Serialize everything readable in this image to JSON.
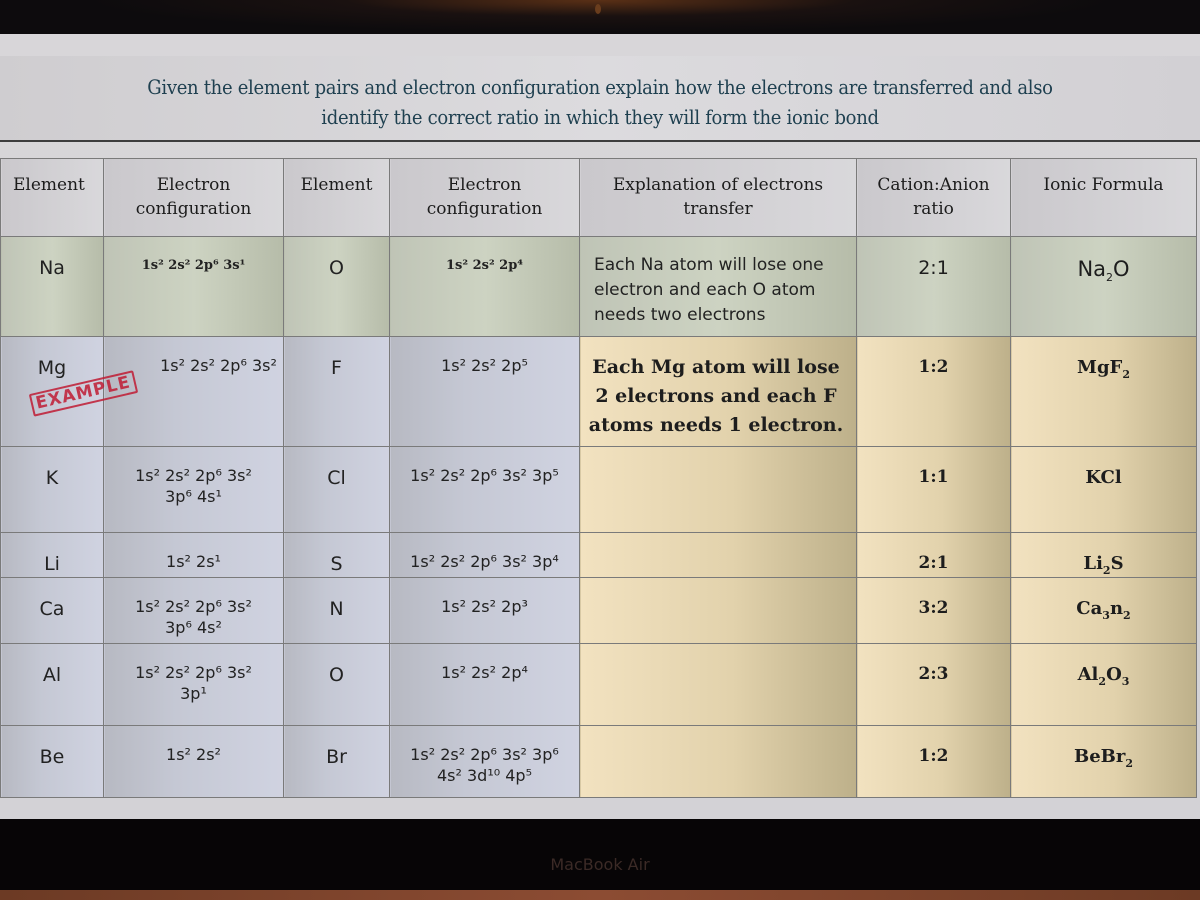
{
  "device": {
    "brand_label": "MacBook Air"
  },
  "worksheet": {
    "title_line1": "Given the element pairs and electron configuration explain how the electrons are transferred and also",
    "title_line2": "identify the correct ratio in which they will form the ionic bond",
    "stamp": "EXAMPLE",
    "headers": {
      "element1": "Element",
      "config1_line1": "Electron",
      "config1_line2": "configuration",
      "element2": "Element",
      "config2_line1": "Electron",
      "config2_line2": "configuration",
      "explanation_line1": "Explanation of electrons",
      "explanation_line2": "transfer",
      "ratio_line1": "Cation:Anion",
      "ratio_line2": "ratio",
      "formula": "Ionic Formula"
    },
    "rows": [
      {
        "element1": "Na",
        "config1": [
          "1s² 2s² 2p⁶ 3s¹"
        ],
        "element2": "O",
        "config2": [
          "1s² 2s² 2p⁴"
        ],
        "explanation": [
          "Each Na atom will lose one",
          "electron and each O atom",
          "needs two electrons"
        ],
        "ratio": "2:1",
        "formula": {
          "parts": [
            [
              "Na",
              "2"
            ],
            [
              "O",
              ""
            ]
          ]
        }
      },
      {
        "element1": "Mg",
        "config1": [
          "1s² 2s² 2p⁶ 3s²"
        ],
        "element2": "F",
        "config2": [
          "1s² 2s² 2p⁵"
        ],
        "explanation": [
          "Each Mg atom will lose",
          "2 electrons and each F",
          "atoms needs 1 electron."
        ],
        "ratio": "1:2",
        "formula": {
          "parts": [
            [
              "MgF",
              "2"
            ]
          ]
        }
      },
      {
        "element1": "K",
        "config1": [
          "1s² 2s² 2p⁶ 3s²",
          "3p⁶ 4s¹"
        ],
        "element2": "Cl",
        "config2": [
          "1s² 2s² 2p⁶ 3s² 3p⁵"
        ],
        "explanation": [],
        "ratio": "1:1",
        "formula": {
          "parts": [
            [
              "KCl",
              ""
            ]
          ]
        }
      },
      {
        "element1": "Li",
        "config1": [
          "1s² 2s¹"
        ],
        "element2": "S",
        "config2": [
          "1s² 2s² 2p⁶ 3s² 3p⁴"
        ],
        "explanation": [],
        "ratio": "2:1",
        "formula": {
          "parts": [
            [
              "Li",
              "2"
            ],
            [
              "S",
              ""
            ]
          ]
        }
      },
      {
        "element1": "Ca",
        "config1": [
          "1s² 2s² 2p⁶ 3s²",
          "3p⁶ 4s²"
        ],
        "element2": "N",
        "config2": [
          "1s² 2s² 2p³"
        ],
        "explanation": [],
        "ratio": "3:2",
        "formula": {
          "parts": [
            [
              "Ca",
              "3"
            ],
            [
              "n",
              "2"
            ]
          ]
        }
      },
      {
        "element1": "Al",
        "config1": [
          "1s² 2s² 2p⁶ 3s²",
          "3p¹"
        ],
        "element2": "O",
        "config2": [
          "1s² 2s² 2p⁴"
        ],
        "explanation": [],
        "ratio": "2:3",
        "formula": {
          "parts": [
            [
              "Al",
              "2"
            ],
            [
              "O",
              "3"
            ]
          ]
        }
      },
      {
        "element1": "Be",
        "config1": [
          "1s² 2s²"
        ],
        "element2": "Br",
        "config2": [
          "1s² 2s² 2p⁶ 3s² 3p⁶",
          "4s² 3d¹⁰ 4p⁵"
        ],
        "explanation": [],
        "ratio": "1:2",
        "formula": {
          "parts": [
            [
              "BeBr",
              "2"
            ]
          ]
        }
      }
    ]
  }
}
